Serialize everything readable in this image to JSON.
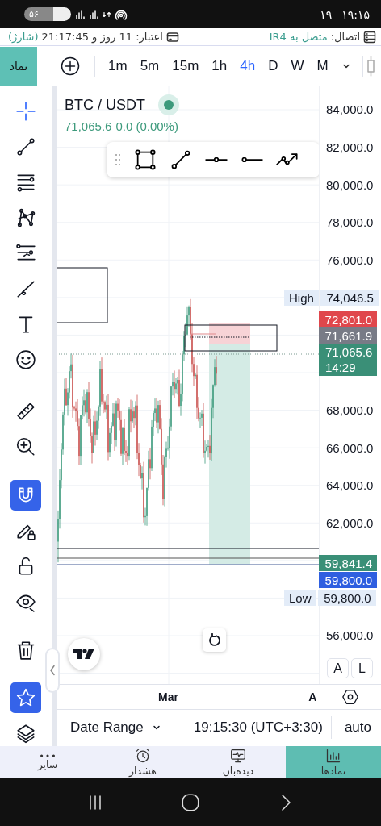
{
  "status_bar": {
    "battery": "۵۶",
    "date": "۱۹",
    "time": "۱۹:۱۵"
  },
  "info_bar": {
    "connection_label": "اتصال:",
    "connection_value": "متصل به IR4",
    "credit": "اعتبار: 11 روز و 21:17:45",
    "credit_note": "(شارژ)"
  },
  "toolbar": {
    "symbol_button": "نماد",
    "intervals": [
      {
        "label": "1m",
        "selected": false
      },
      {
        "label": "5m",
        "selected": false
      },
      {
        "label": "15m",
        "selected": false
      },
      {
        "label": "1h",
        "selected": false
      },
      {
        "label": "4h",
        "selected": true
      },
      {
        "label": "D",
        "selected": false
      },
      {
        "label": "W",
        "selected": false
      },
      {
        "label": "M",
        "selected": false
      }
    ]
  },
  "side_tools": [
    [
      {
        "kind": "crosshair",
        "active": true
      },
      {
        "kind": "trendline",
        "active": false
      },
      {
        "kind": "fibonacci",
        "active": false
      },
      {
        "kind": "pattern",
        "active": false
      },
      {
        "kind": "forecast",
        "active": false
      },
      {
        "kind": "brush",
        "active": false
      },
      {
        "kind": "text",
        "active": false
      },
      {
        "kind": "emoji",
        "active": false
      }
    ],
    [
      {
        "kind": "ruler",
        "active": false
      },
      {
        "kind": "zoom",
        "active": false
      }
    ],
    [
      {
        "kind": "magnet",
        "active": true
      },
      {
        "kind": "lock-pencil",
        "active": false
      },
      {
        "kind": "unlock",
        "active": false
      },
      {
        "kind": "eye",
        "active": false
      }
    ],
    [
      {
        "kind": "trash",
        "active": false
      },
      {
        "kind": "star",
        "active": true
      },
      {
        "kind": "layers",
        "active": false
      }
    ]
  ],
  "chart": {
    "symbol": "BTC / USDT",
    "last": "71,065.6",
    "change": "0.0 (0.00%)",
    "price_ticks": [
      "84,000.0",
      "82,000.0",
      "80,000.0",
      "78,000.0",
      "76,000.0",
      "68,000.0",
      "66,000.0",
      "64,000.0",
      "62,000.0",
      "56,000.0"
    ],
    "high": {
      "label": "High",
      "value": "74,046.5"
    },
    "price_badges": [
      {
        "value": "72,801.0",
        "color": "#e0474c"
      },
      {
        "value": "71,661.9",
        "color": "#787b86"
      },
      {
        "value": "71,065.6",
        "countdown": "14:29",
        "color": "#3a8f77"
      },
      {
        "value": "59,841.4",
        "color": "#3a8f77"
      },
      {
        "value": "59,800.0",
        "color": "#2f5fe0"
      }
    ],
    "low": {
      "label": "Low",
      "value": "59,800.0"
    },
    "scale_buttons": [
      "A",
      "L"
    ],
    "time_labels": [
      "Mar",
      "A"
    ]
  },
  "bottom_bar": {
    "date_range": "Date Range",
    "clock": "19:15:30 (UTC+3:30)",
    "scale_mode": "auto"
  },
  "nav": [
    {
      "kind": "symbols",
      "label": "نمادها",
      "selected": true
    },
    {
      "kind": "watchlist",
      "label": "دیده‌بان",
      "selected": false
    },
    {
      "kind": "alerts",
      "label": "هشدار",
      "selected": false
    },
    {
      "kind": "more",
      "label": "سایر",
      "selected": false
    }
  ]
}
